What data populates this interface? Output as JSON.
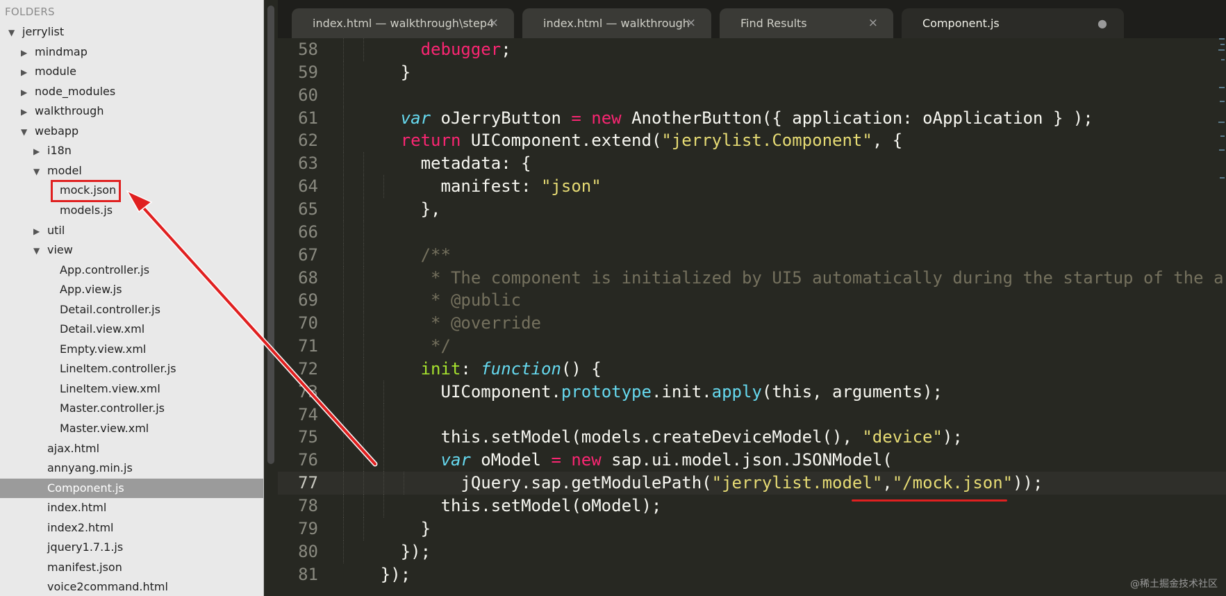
{
  "sidebar": {
    "header": "FOLDERS",
    "items": [
      {
        "label": "jerrylist",
        "indent": 0,
        "state": "open"
      },
      {
        "label": "mindmap",
        "indent": 1,
        "state": "closed"
      },
      {
        "label": "module",
        "indent": 1,
        "state": "closed"
      },
      {
        "label": "node_modules",
        "indent": 1,
        "state": "closed"
      },
      {
        "label": "walkthrough",
        "indent": 1,
        "state": "closed"
      },
      {
        "label": "webapp",
        "indent": 1,
        "state": "open"
      },
      {
        "label": "i18n",
        "indent": 2,
        "state": "closed"
      },
      {
        "label": "model",
        "indent": 2,
        "state": "open"
      },
      {
        "label": "mock.json",
        "indent": 3,
        "state": "file",
        "highlighted": true
      },
      {
        "label": "models.js",
        "indent": 3,
        "state": "file"
      },
      {
        "label": "util",
        "indent": 2,
        "state": "closed"
      },
      {
        "label": "view",
        "indent": 2,
        "state": "open"
      },
      {
        "label": "App.controller.js",
        "indent": 3,
        "state": "file"
      },
      {
        "label": "App.view.js",
        "indent": 3,
        "state": "file"
      },
      {
        "label": "Detail.controller.js",
        "indent": 3,
        "state": "file"
      },
      {
        "label": "Detail.view.xml",
        "indent": 3,
        "state": "file"
      },
      {
        "label": "Empty.view.xml",
        "indent": 3,
        "state": "file"
      },
      {
        "label": "LineItem.controller.js",
        "indent": 3,
        "state": "file"
      },
      {
        "label": "LineItem.view.xml",
        "indent": 3,
        "state": "file"
      },
      {
        "label": "Master.controller.js",
        "indent": 3,
        "state": "file"
      },
      {
        "label": "Master.view.xml",
        "indent": 3,
        "state": "file"
      },
      {
        "label": "ajax.html",
        "indent": 2,
        "state": "file"
      },
      {
        "label": "annyang.min.js",
        "indent": 2,
        "state": "file"
      },
      {
        "label": "Component.js",
        "indent": 2,
        "state": "file",
        "selected": true
      },
      {
        "label": "index.html",
        "indent": 2,
        "state": "file"
      },
      {
        "label": "index2.html",
        "indent": 2,
        "state": "file"
      },
      {
        "label": "jquery1.7.1.js",
        "indent": 2,
        "state": "file"
      },
      {
        "label": "manifest.json",
        "indent": 2,
        "state": "file"
      },
      {
        "label": "voice2command.html",
        "indent": 2,
        "state": "file"
      }
    ]
  },
  "tabs": [
    {
      "label": "index.html — walkthrough\\step4",
      "active": false,
      "marker": "×"
    },
    {
      "label": "index.html — walkthrough",
      "active": false,
      "marker": "×"
    },
    {
      "label": "Find Results",
      "active": false,
      "marker": "×"
    },
    {
      "label": "Component.js",
      "active": true,
      "marker": "●"
    }
  ],
  "editor": {
    "current_line": 77,
    "lines": [
      {
        "n": "58",
        "depth": 2,
        "tokens": [
          [
            "        ",
            ""
          ],
          [
            "debugger",
            "k"
          ],
          [
            ";",
            ""
          ]
        ]
      },
      {
        "n": "59",
        "depth": 1,
        "tokens": [
          [
            "      }",
            ""
          ]
        ]
      },
      {
        "n": "60",
        "depth": 1,
        "tokens": []
      },
      {
        "n": "61",
        "depth": 1,
        "tokens": [
          [
            "      ",
            ""
          ],
          [
            "var",
            "i"
          ],
          [
            " oJerryButton ",
            ""
          ],
          [
            "=",
            "o"
          ],
          [
            " ",
            ""
          ],
          [
            "new",
            "k"
          ],
          [
            " AnotherButton({ application: oApplication } );",
            ""
          ]
        ]
      },
      {
        "n": "62",
        "depth": 1,
        "tokens": [
          [
            "      ",
            ""
          ],
          [
            "return",
            "k"
          ],
          [
            " UIComponent.extend(",
            ""
          ],
          [
            "\"jerrylist.Component\"",
            "s"
          ],
          [
            ", {",
            ""
          ]
        ]
      },
      {
        "n": "63",
        "depth": 2,
        "tokens": [
          [
            "        metadata: {",
            ""
          ]
        ]
      },
      {
        "n": "64",
        "depth": 3,
        "tokens": [
          [
            "          manifest: ",
            ""
          ],
          [
            "\"json\"",
            "s"
          ]
        ]
      },
      {
        "n": "65",
        "depth": 2,
        "tokens": [
          [
            "        },",
            ""
          ]
        ]
      },
      {
        "n": "66",
        "depth": 2,
        "tokens": []
      },
      {
        "n": "67",
        "depth": 2,
        "tokens": [
          [
            "        /**",
            "c"
          ]
        ]
      },
      {
        "n": "68",
        "depth": 2,
        "tokens": [
          [
            "         * The component is initialized by UI5 automatically during the startup of the a",
            "c"
          ]
        ]
      },
      {
        "n": "69",
        "depth": 2,
        "tokens": [
          [
            "         * @public",
            "c"
          ]
        ]
      },
      {
        "n": "70",
        "depth": 2,
        "tokens": [
          [
            "         * @override",
            "c"
          ]
        ]
      },
      {
        "n": "71",
        "depth": 2,
        "tokens": [
          [
            "         */",
            "c"
          ]
        ]
      },
      {
        "n": "72",
        "depth": 2,
        "tokens": [
          [
            "        ",
            ""
          ],
          [
            "init",
            "g"
          ],
          [
            ": ",
            ""
          ],
          [
            "function",
            "i"
          ],
          [
            "() {",
            ""
          ]
        ]
      },
      {
        "n": "73",
        "depth": 3,
        "tokens": [
          [
            "          UIComponent.",
            ""
          ],
          [
            "prototype",
            "f"
          ],
          [
            ".init.",
            ""
          ],
          [
            "apply",
            "f"
          ],
          [
            "(this, arguments);",
            ""
          ]
        ]
      },
      {
        "n": "74",
        "depth": 3,
        "tokens": []
      },
      {
        "n": "75",
        "depth": 3,
        "tokens": [
          [
            "          this.setModel(models.createDeviceModel(), ",
            ""
          ],
          [
            "\"device\"",
            "s"
          ],
          [
            ");",
            ""
          ]
        ]
      },
      {
        "n": "76",
        "depth": 3,
        "tokens": [
          [
            "          ",
            ""
          ],
          [
            "var",
            "i"
          ],
          [
            " oModel ",
            ""
          ],
          [
            "=",
            "o"
          ],
          [
            " ",
            ""
          ],
          [
            "new",
            "k"
          ],
          [
            " sap.ui.model.json.JSONModel(",
            ""
          ]
        ]
      },
      {
        "n": "77",
        "depth": 4,
        "tokens": [
          [
            "            jQuery.sap.getModulePath(",
            ""
          ],
          [
            "\"jerrylist.model\"",
            "s"
          ],
          [
            ",",
            ""
          ],
          [
            "\"/mock.json\"",
            "s"
          ],
          [
            "));",
            ""
          ]
        ]
      },
      {
        "n": "78",
        "depth": 3,
        "tokens": [
          [
            "          this.setModel(oModel);",
            ""
          ]
        ]
      },
      {
        "n": "79",
        "depth": 2,
        "tokens": [
          [
            "        }",
            ""
          ]
        ]
      },
      {
        "n": "80",
        "depth": 1,
        "tokens": [
          [
            "      });",
            ""
          ]
        ]
      },
      {
        "n": "81",
        "depth": 0,
        "tokens": [
          [
            "    });",
            ""
          ]
        ]
      }
    ]
  },
  "watermark": "@稀土掘金技术社区",
  "colors": {
    "annotation": "#e02020",
    "keyword": "#f92672",
    "string": "#e6db74",
    "comment": "#75715e"
  }
}
